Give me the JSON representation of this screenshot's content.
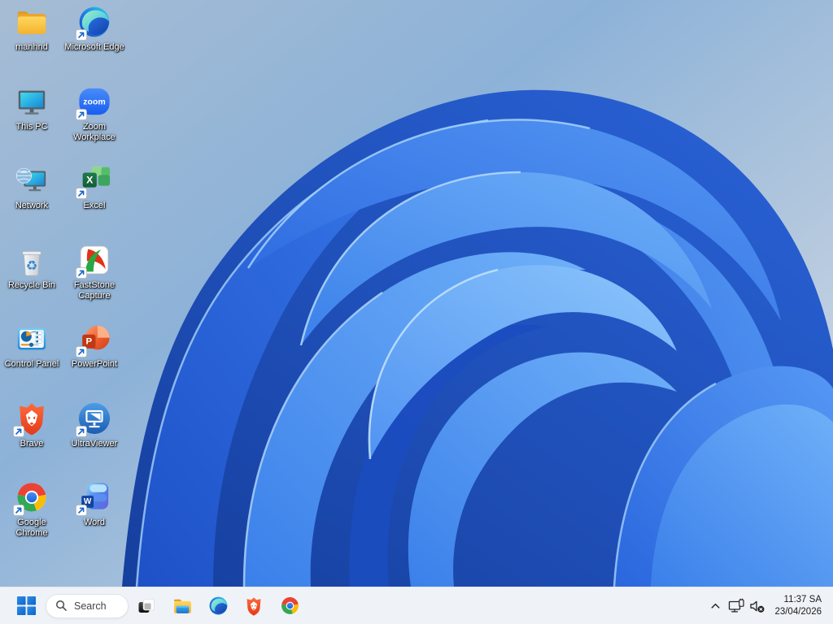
{
  "desktop": {
    "icons": [
      {
        "label": "manhnd",
        "icon": "folder-icon",
        "shortcut": false
      },
      {
        "label": "This PC",
        "icon": "this-pc-icon",
        "shortcut": false
      },
      {
        "label": "Network",
        "icon": "network-icon",
        "shortcut": false
      },
      {
        "label": "Recycle Bin",
        "icon": "recycle-bin-icon",
        "shortcut": false
      },
      {
        "label": "Control Panel",
        "icon": "control-panel-icon",
        "shortcut": false
      },
      {
        "label": "Brave",
        "icon": "brave-icon",
        "shortcut": true
      },
      {
        "label": "Google Chrome",
        "icon": "chrome-icon",
        "shortcut": true
      },
      {
        "label": "Microsoft Edge",
        "icon": "edge-icon",
        "shortcut": true
      },
      {
        "label": "Zoom Workplace",
        "icon": "zoom-icon",
        "shortcut": true
      },
      {
        "label": "Excel",
        "icon": "excel-icon",
        "shortcut": true
      },
      {
        "label": "FastStone Capture",
        "icon": "faststone-icon",
        "shortcut": true
      },
      {
        "label": "PowerPoint",
        "icon": "powerpoint-icon",
        "shortcut": true
      },
      {
        "label": "UltraViewer",
        "icon": "ultraviewer-icon",
        "shortcut": true
      },
      {
        "label": "Word",
        "icon": "word-icon",
        "shortcut": true
      }
    ],
    "icon_glyphs": {
      "zoom": "zoom",
      "excel": "X",
      "powerpoint": "P",
      "word": "W",
      "recycle": "♻"
    }
  },
  "taskbar": {
    "search": {
      "label": "Search"
    },
    "pinned": [
      "start",
      "search",
      "task-view",
      "file-explorer",
      "edge",
      "brave",
      "chrome"
    ],
    "tray": {
      "hidden_icons_icon": "chevron-up-icon",
      "network_icon": "ethernet-network-icon",
      "volume_icon": "volume-muted-icon",
      "time": "11:37 SA",
      "date": "23/04/2026"
    }
  },
  "colors": {
    "taskbar_bg": "#eff3f8",
    "start_blue": "#1173d4",
    "wallpaper_blue_dark": "#163f9e",
    "wallpaper_blue_light": "#8cc6fb",
    "desktop_bg_top": "#8db2d8",
    "desktop_bg_bottom": "#d8e2ee"
  }
}
